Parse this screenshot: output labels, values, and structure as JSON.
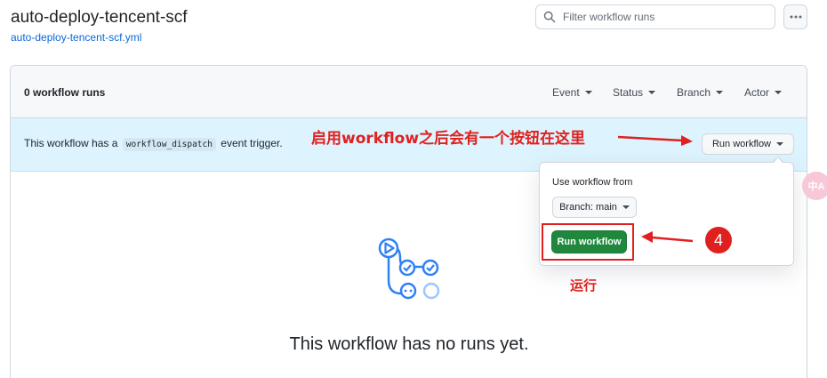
{
  "header": {
    "title": "auto-deploy-tencent-scf",
    "workflow_file": "auto-deploy-tencent-scf.yml",
    "search_placeholder": "Filter workflow runs",
    "more_icon": "kebab-horizontal-icon"
  },
  "list": {
    "runs_count": "0 workflow runs",
    "filters": [
      "Event",
      "Status",
      "Branch",
      "Actor"
    ]
  },
  "banner": {
    "text_before": "This workflow has a",
    "code": "workflow_dispatch",
    "text_after": "event trigger.",
    "run_button": "Run workflow"
  },
  "popover": {
    "use_label": "Use workflow from",
    "branch_button": "Branch: main",
    "submit_button": "Run workflow"
  },
  "empty_state": {
    "title": "This workflow has no runs yet.",
    "icon": "workflow-icon"
  },
  "annotations": {
    "top_note": "启用workflow之后会有一个按钮在这里",
    "step_number": "4",
    "run_note": "运行"
  },
  "translate_widget": "中A",
  "colors": {
    "link": "#0969da",
    "banner_bg": "#ddf4ff",
    "primary_button": "#1f883d",
    "annotation_red": "#e0201e",
    "icon_blue": "#2f81f7"
  }
}
